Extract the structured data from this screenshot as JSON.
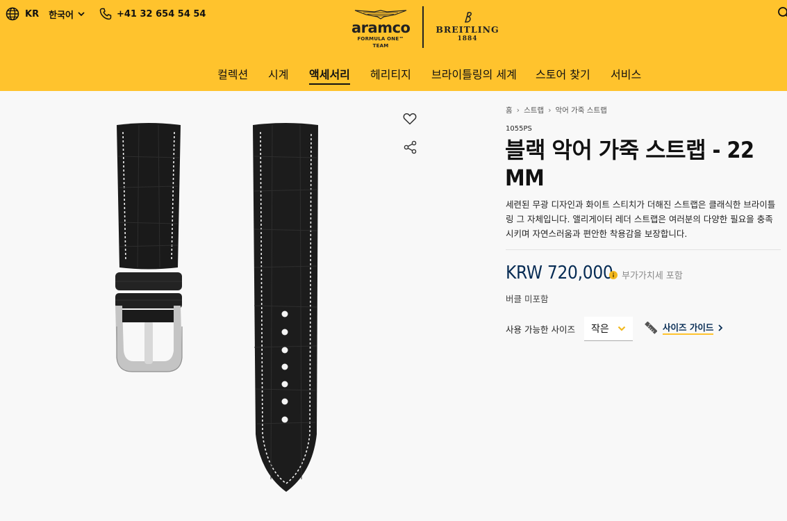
{
  "topbar": {
    "country": "KR",
    "language": "한국어",
    "phone": "+41 32 654 54 54"
  },
  "logos": {
    "aramco": "aramco",
    "aramco_sub": "FORMULA ONE™ TEAM",
    "aston_martin": "ASTON MARTIN",
    "breitling": "BREITLING",
    "breitling_year": "1884"
  },
  "nav": {
    "items": [
      {
        "label": "컬렉션"
      },
      {
        "label": "시계"
      },
      {
        "label": "액세서리",
        "active": true
      },
      {
        "label": "헤리티지"
      },
      {
        "label": "브라이틀링의 세계"
      },
      {
        "label": "스토어 찾기"
      },
      {
        "label": "서비스"
      }
    ]
  },
  "breadcrumb": {
    "items": [
      {
        "label": "홈"
      },
      {
        "label": "스트랩"
      },
      {
        "label": "악어 가죽 스트랩"
      }
    ]
  },
  "product": {
    "sku": "1055PS",
    "title": "블랙 악어 가죽 스트랩 - 22 MM",
    "description": "세련된 무광 디자인과 화이트 스티치가 더해진 스트랩은 클래식한 브라이틀링 그 자체입니다. 앨리게이터 레더 스트랩은 여러분의 다양한 필요을 충족시키며 자연스러움과 편안한 착용감을 보장합니다.",
    "price": "KRW 720,000",
    "vat_note": "부가가치세 포함",
    "buckle_note": "버클 미포함",
    "size_label": "사용 가능한 사이즈",
    "size_selected": "작은",
    "size_guide": "사이즈 가이드"
  },
  "colors": {
    "header_yellow": "#ffc32d",
    "navy": "#072c54",
    "strap_black": "#1a1a1a",
    "stitch": "#f2f2f2"
  },
  "icons": {
    "globe": "globe-icon",
    "language_chevron": "chevron-down-icon",
    "phone": "phone-icon",
    "search": "search-icon",
    "wishlist": "heart-icon",
    "share": "share-icon",
    "vat_info": "info-icon",
    "size_chevron": "chevron-down-icon",
    "ruler": "ruler-icon",
    "size_guide_arrow": "chevron-right-icon"
  }
}
